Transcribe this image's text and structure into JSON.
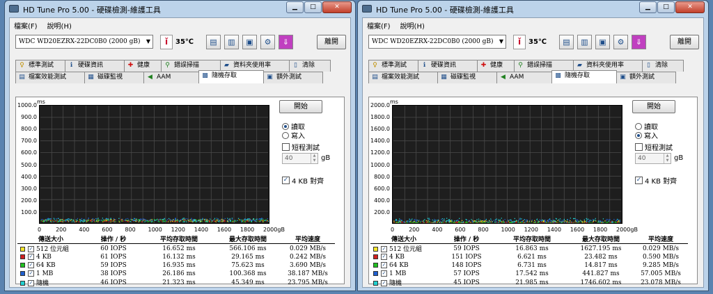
{
  "windows": [
    {
      "title": "HD Tune Pro  5.00 - 硬碟檢測-維護工具",
      "menu": [
        "檔案(F)",
        "說明(H)"
      ],
      "drive": "WDC WD20EZRX-22DC0B0 (2000 gB)",
      "temperature": "35℃",
      "exit_label": "離開",
      "tabs_row1": [
        {
          "label": "標準測試",
          "icon": "bulb-icon"
        },
        {
          "label": "硬碟資訊",
          "icon": "info-icon"
        },
        {
          "label": "健康",
          "icon": "health-cross-icon"
        },
        {
          "label": "錯誤掃描",
          "icon": "magnifier-icon"
        },
        {
          "label": "資料夾使用率",
          "icon": "folder-icon"
        },
        {
          "label": "清除",
          "icon": "trash-icon"
        }
      ],
      "tabs_row2": [
        {
          "label": "檔案效能測試",
          "icon": "file-icon"
        },
        {
          "label": "磁碟監視",
          "icon": "monitor-icon"
        },
        {
          "label": "AAM",
          "icon": "speaker-icon"
        },
        {
          "label": "隨機存取",
          "icon": "random-icon",
          "active": true
        },
        {
          "label": "額外測試",
          "icon": "extra-icon"
        }
      ],
      "start_label": "開始",
      "read_label": "讀取",
      "write_label": "寫入",
      "mode_selected": "read",
      "short_test_label": "短程測試",
      "short_test_checked": false,
      "short_value": "40",
      "short_unit": "gB",
      "align_label": "4 KB 對齊",
      "align_checked": true,
      "chart_data": {
        "type": "scatter",
        "title": "",
        "xlabel": "",
        "ylabel": "ms",
        "ylim": [
          0,
          1000
        ],
        "xlim": [
          0,
          2000
        ],
        "yticks": [
          "1000.0",
          "900.0",
          "800.0",
          "700.0",
          "600.0",
          "500.0",
          "400.0",
          "300.0",
          "200.0",
          "100.0"
        ],
        "xticks": [
          "0",
          "200",
          "400",
          "600",
          "800",
          "1000",
          "1200",
          "1400",
          "1600",
          "1800",
          "2000gB"
        ],
        "grid": true,
        "series": [
          {
            "name": "512 位元組",
            "color": "#f5e52a",
            "band": [
              8,
              30
            ]
          },
          {
            "name": "4 KB",
            "color": "#d02020",
            "band": [
              8,
              25
            ]
          },
          {
            "name": "64 KB",
            "color": "#20c020",
            "band": [
              8,
              30
            ]
          },
          {
            "name": "1 MB",
            "color": "#2060d0",
            "band": [
              15,
              40
            ]
          },
          {
            "name": "隨機",
            "color": "#20d0d0",
            "band": [
              8,
              40
            ]
          }
        ]
      },
      "table": {
        "headers": [
          "傳送大小",
          "操作 / 秒",
          "平均存取時間",
          "最大存取時間",
          "平均速度"
        ],
        "rows": [
          {
            "name": "512 位元組",
            "color": "#f5e52a",
            "iops": "60 IOPS",
            "avg": "16.652 ms",
            "max": "566.106 ms",
            "speed": "0.029 MB/s"
          },
          {
            "name": "4 KB",
            "color": "#d02020",
            "iops": "61 IOPS",
            "avg": "16.132 ms",
            "max": "29.165 ms",
            "speed": "0.242 MB/s"
          },
          {
            "name": "64 KB",
            "color": "#20c020",
            "iops": "59 IOPS",
            "avg": "16.935 ms",
            "max": "75.623 ms",
            "speed": "3.690 MB/s"
          },
          {
            "name": "1 MB",
            "color": "#2060d0",
            "iops": "38 IOPS",
            "avg": "26.186 ms",
            "max": "100.368 ms",
            "speed": "38.187 MB/s"
          },
          {
            "name": "隨機",
            "color": "#20d0d0",
            "iops": "46 IOPS",
            "avg": "21.323 ms",
            "max": "45.349 ms",
            "speed": "23.795 MB/s"
          }
        ]
      }
    },
    {
      "title": "HD Tune Pro  5.00 - 硬碟檢測-維護工具",
      "menu": [
        "檔案(F)",
        "說明(H)"
      ],
      "drive": "WDC WD20EZRX-22DC0B0 (2000 gB)",
      "temperature": "35℃",
      "exit_label": "離開",
      "tabs_row1": [
        {
          "label": "標準測試",
          "icon": "bulb-icon"
        },
        {
          "label": "硬碟資訊",
          "icon": "info-icon"
        },
        {
          "label": "健康",
          "icon": "health-cross-icon"
        },
        {
          "label": "錯誤掃描",
          "icon": "magnifier-icon"
        },
        {
          "label": "資料夾使用率",
          "icon": "folder-icon"
        },
        {
          "label": "清除",
          "icon": "trash-icon"
        }
      ],
      "tabs_row2": [
        {
          "label": "檔案效能測試",
          "icon": "file-icon"
        },
        {
          "label": "磁碟監視",
          "icon": "monitor-icon"
        },
        {
          "label": "AAM",
          "icon": "speaker-icon"
        },
        {
          "label": "隨機存取",
          "icon": "random-icon",
          "active": true
        },
        {
          "label": "額外測試",
          "icon": "extra-icon"
        }
      ],
      "start_label": "開始",
      "read_label": "讀取",
      "write_label": "寫入",
      "mode_selected": "write",
      "short_test_label": "短程測試",
      "short_test_checked": false,
      "short_value": "40",
      "short_unit": "gB",
      "align_label": "4 KB 對齊",
      "align_checked": true,
      "chart_data": {
        "type": "scatter",
        "title": "",
        "xlabel": "",
        "ylabel": "ms",
        "ylim": [
          0,
          2000
        ],
        "xlim": [
          0,
          2000
        ],
        "yticks": [
          "2000.0",
          "1800.0",
          "1600.0",
          "1400.0",
          "1200.0",
          "1000.0",
          "800.0",
          "600.0",
          "400.0",
          "200.0"
        ],
        "xticks": [
          "0",
          "200",
          "400",
          "600",
          "800",
          "1000",
          "1200",
          "1400",
          "1600",
          "1800",
          "2000gB"
        ],
        "grid": true,
        "series": [
          {
            "name": "512 位元組",
            "color": "#f5e52a",
            "band": [
              5,
              40
            ]
          },
          {
            "name": "4 KB",
            "color": "#d02020",
            "band": [
              3,
              15
            ]
          },
          {
            "name": "64 KB",
            "color": "#20c020",
            "band": [
              3,
              15
            ]
          },
          {
            "name": "1 MB",
            "color": "#2060d0",
            "band": [
              10,
              60
            ]
          },
          {
            "name": "隨機",
            "color": "#20d0d0",
            "band": [
              5,
              80
            ]
          }
        ]
      },
      "table": {
        "headers": [
          "傳送大小",
          "操作 / 秒",
          "平均存取時間",
          "最大存取時間",
          "平均速度"
        ],
        "rows": [
          {
            "name": "512 位元組",
            "color": "#f5e52a",
            "iops": "59 IOPS",
            "avg": "16.863 ms",
            "max": "1627.195 ms",
            "speed": "0.029 MB/s"
          },
          {
            "name": "4 KB",
            "color": "#d02020",
            "iops": "151 IOPS",
            "avg": "6.621 ms",
            "max": "23.482 ms",
            "speed": "0.590 MB/s"
          },
          {
            "name": "64 KB",
            "color": "#20c020",
            "iops": "148 IOPS",
            "avg": "6.731 ms",
            "max": "14.817 ms",
            "speed": "9.285 MB/s"
          },
          {
            "name": "1 MB",
            "color": "#2060d0",
            "iops": "57 IOPS",
            "avg": "17.542 ms",
            "max": "441.827 ms",
            "speed": "57.005 MB/s"
          },
          {
            "name": "隨機",
            "color": "#20d0d0",
            "iops": "45 IOPS",
            "avg": "21.985 ms",
            "max": "1746.602 ms",
            "speed": "23.078 MB/s"
          }
        ]
      }
    }
  ]
}
